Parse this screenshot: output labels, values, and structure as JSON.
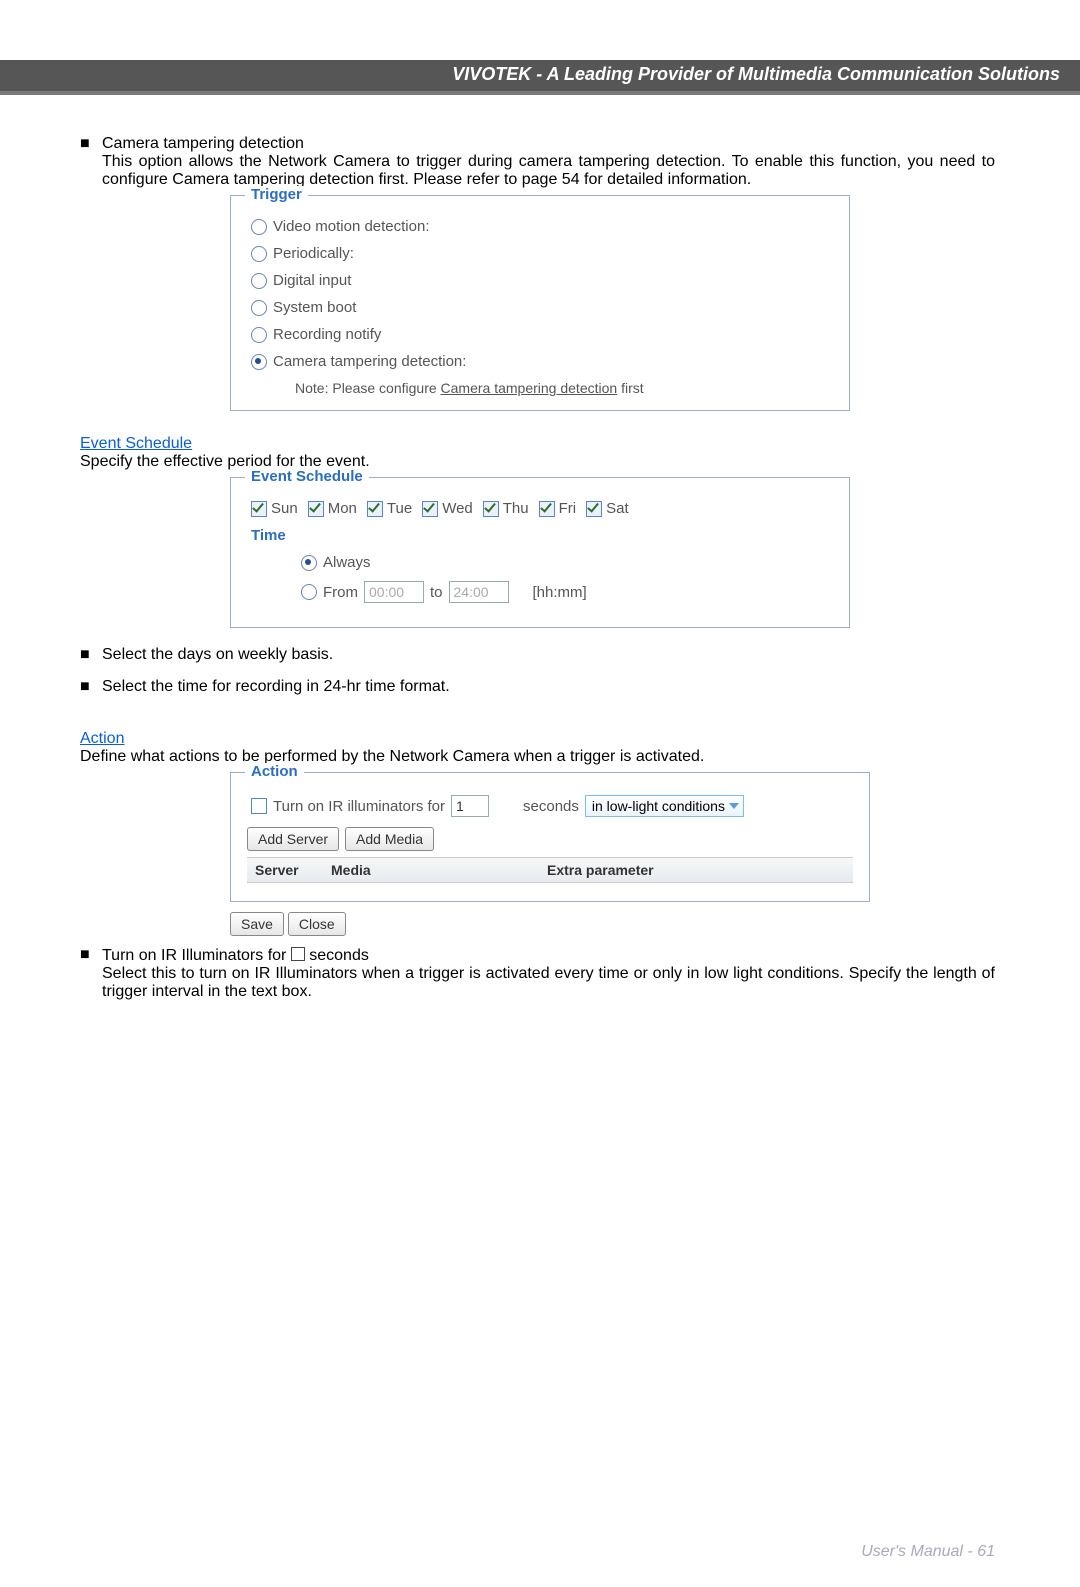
{
  "header": {
    "title": "VIVOTEK - A Leading Provider of Multimedia Communication Solutions"
  },
  "section_trigger": {
    "bullet_title": "Camera tampering detection",
    "para": "This option allows the Network Camera to trigger during camera tampering detection. To enable this function, you need to configure Camera tampering detection first. Please refer to page 54 for detailed information."
  },
  "fig_trigger": {
    "legend": "Trigger",
    "opts": [
      "Video motion detection:",
      "Periodically:",
      "Digital input",
      "System boot",
      "Recording notify",
      "Camera tampering detection:"
    ],
    "note_pre": "Note: Please configure ",
    "note_link": "Camera tampering detection",
    "note_post": " first"
  },
  "section_schedule": {
    "title": "Event Schedule",
    "para": "Specify the effective period for the event."
  },
  "fig_schedule": {
    "legend": "Event Schedule",
    "days": [
      "Sun",
      "Mon",
      "Tue",
      "Wed",
      "Thu",
      "Fri",
      "Sat"
    ],
    "time_label": "Time",
    "opt_always": "Always",
    "opt_from": "From",
    "from_val": "00:00",
    "to_lbl": "to",
    "to_val": "24:00",
    "hhmm": "[hh:mm]"
  },
  "bullets_after_schedule": [
    "Select the days on weekly basis.",
    "Select the time for recording in 24-hr time format."
  ],
  "section_action": {
    "title": "Action",
    "para": "Define what actions to be performed by the Network Camera when a trigger is activated."
  },
  "fig_action": {
    "legend": "Action",
    "ir_label": "Turn on IR illuminators for",
    "ir_val": "1",
    "ir_seconds": "seconds",
    "ir_select": "in low-light conditions",
    "add_server": "Add Server",
    "add_media": "Add Media",
    "tbl_server": "Server",
    "tbl_media": "Media",
    "tbl_extra": "Extra parameter",
    "save": "Save",
    "close": "Close"
  },
  "section_ir": {
    "bullet_pre": "Turn on IR Illuminators for  ",
    "bullet_post": " seconds",
    "para": "Select this to turn on IR Illuminators when a trigger is activated every time or only in low light conditions. Specify the length of trigger interval in the text box."
  },
  "footer": {
    "text": "User's Manual - 61"
  }
}
